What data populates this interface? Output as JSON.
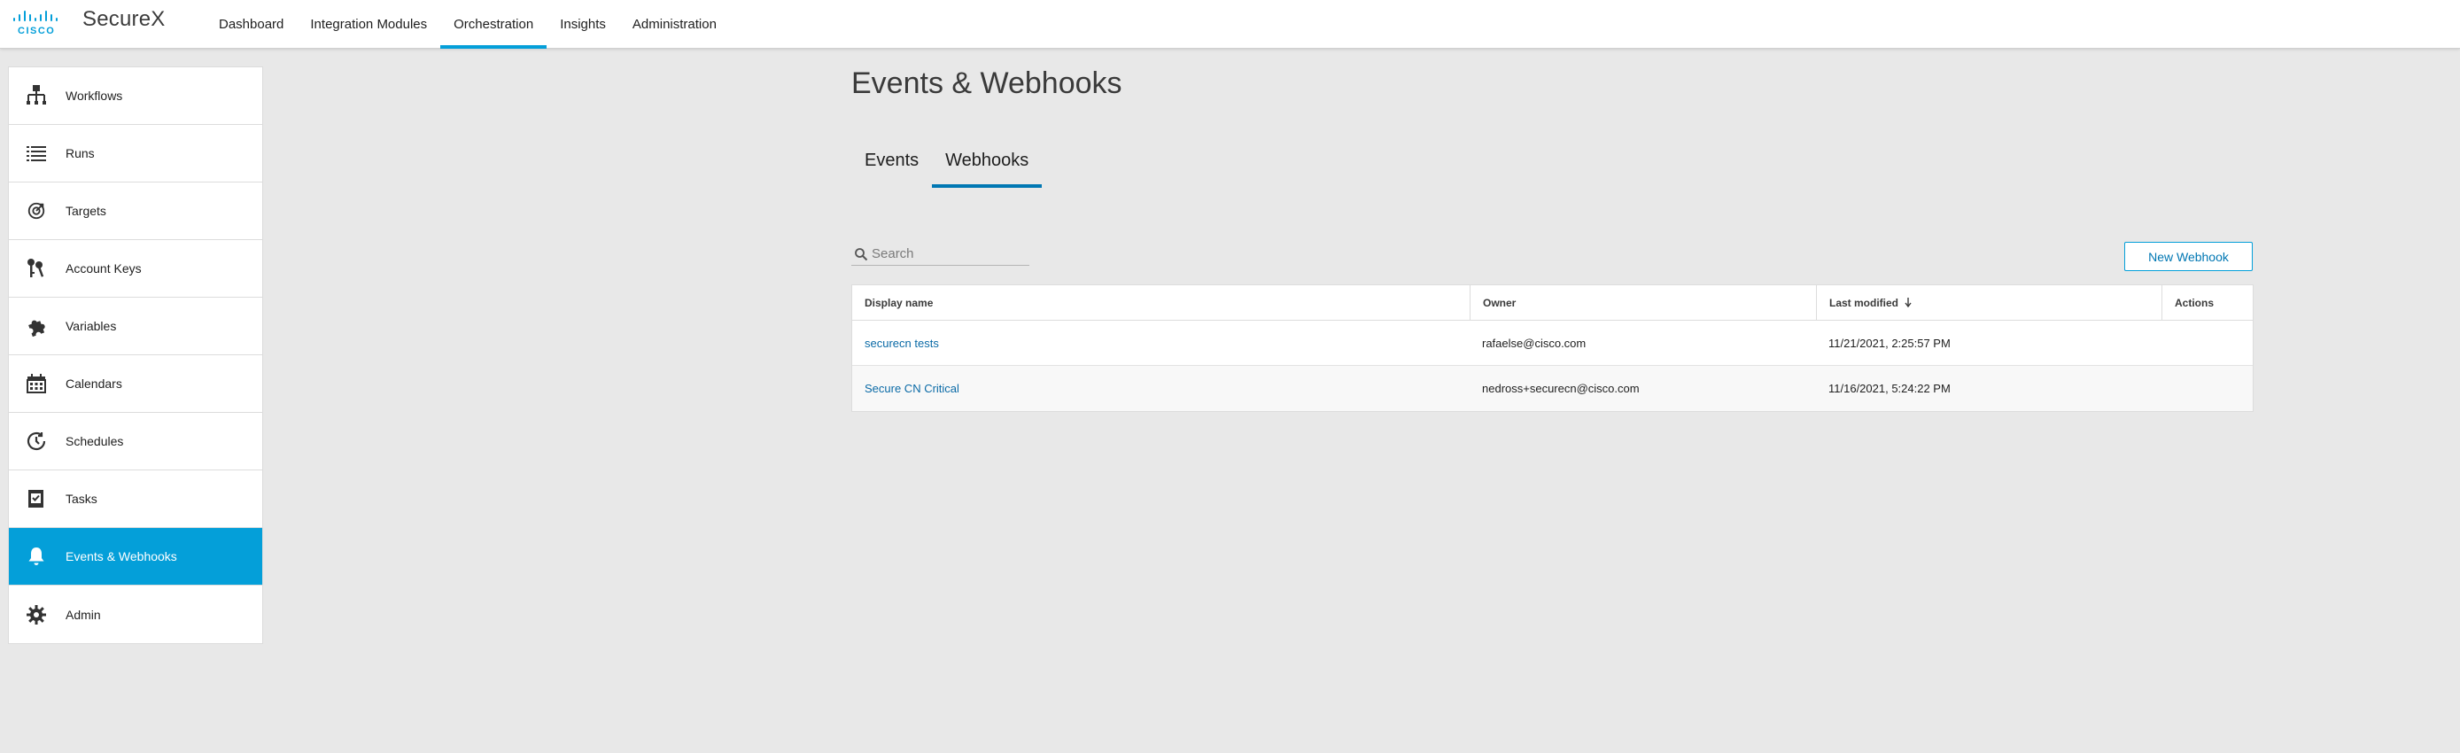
{
  "header": {
    "logo_text": "CISCO",
    "brand": "SecureX",
    "nav": [
      {
        "label": "Dashboard",
        "active": false
      },
      {
        "label": "Integration Modules",
        "active": false
      },
      {
        "label": "Orchestration",
        "active": true
      },
      {
        "label": "Insights",
        "active": false
      },
      {
        "label": "Administration",
        "active": false
      }
    ],
    "accent_color": "#049fd9"
  },
  "sidebar": {
    "items": [
      {
        "label": "Workflows",
        "icon": "workflow-icon",
        "active": false
      },
      {
        "label": "Runs",
        "icon": "list-icon",
        "active": false
      },
      {
        "label": "Targets",
        "icon": "target-icon",
        "active": false
      },
      {
        "label": "Account Keys",
        "icon": "keys-icon",
        "active": false
      },
      {
        "label": "Variables",
        "icon": "puzzle-icon",
        "active": false
      },
      {
        "label": "Calendars",
        "icon": "calendar-icon",
        "active": false
      },
      {
        "label": "Schedules",
        "icon": "schedule-icon",
        "active": false
      },
      {
        "label": "Tasks",
        "icon": "task-icon",
        "active": false
      },
      {
        "label": "Events & Webhooks",
        "icon": "bell-icon",
        "active": true
      },
      {
        "label": "Admin",
        "icon": "gear-icon",
        "active": false
      }
    ]
  },
  "main": {
    "title": "Events & Webhooks",
    "tabs": [
      {
        "label": "Events",
        "active": false
      },
      {
        "label": "Webhooks",
        "active": true
      }
    ],
    "search": {
      "placeholder": "Search",
      "value": ""
    },
    "new_button": "New Webhook",
    "table": {
      "columns": [
        "Display name",
        "Owner",
        "Last modified",
        "Actions"
      ],
      "sorted_column": "Last modified",
      "sort_direction": "descending",
      "rows": [
        {
          "name": "securecn tests",
          "owner": "rafaelse@cisco.com",
          "modified": "11/21/2021, 2:25:57 PM"
        },
        {
          "name": "Secure CN Critical",
          "owner": "nedross+securecn@cisco.com",
          "modified": "11/16/2021, 5:24:22 PM"
        }
      ]
    }
  }
}
